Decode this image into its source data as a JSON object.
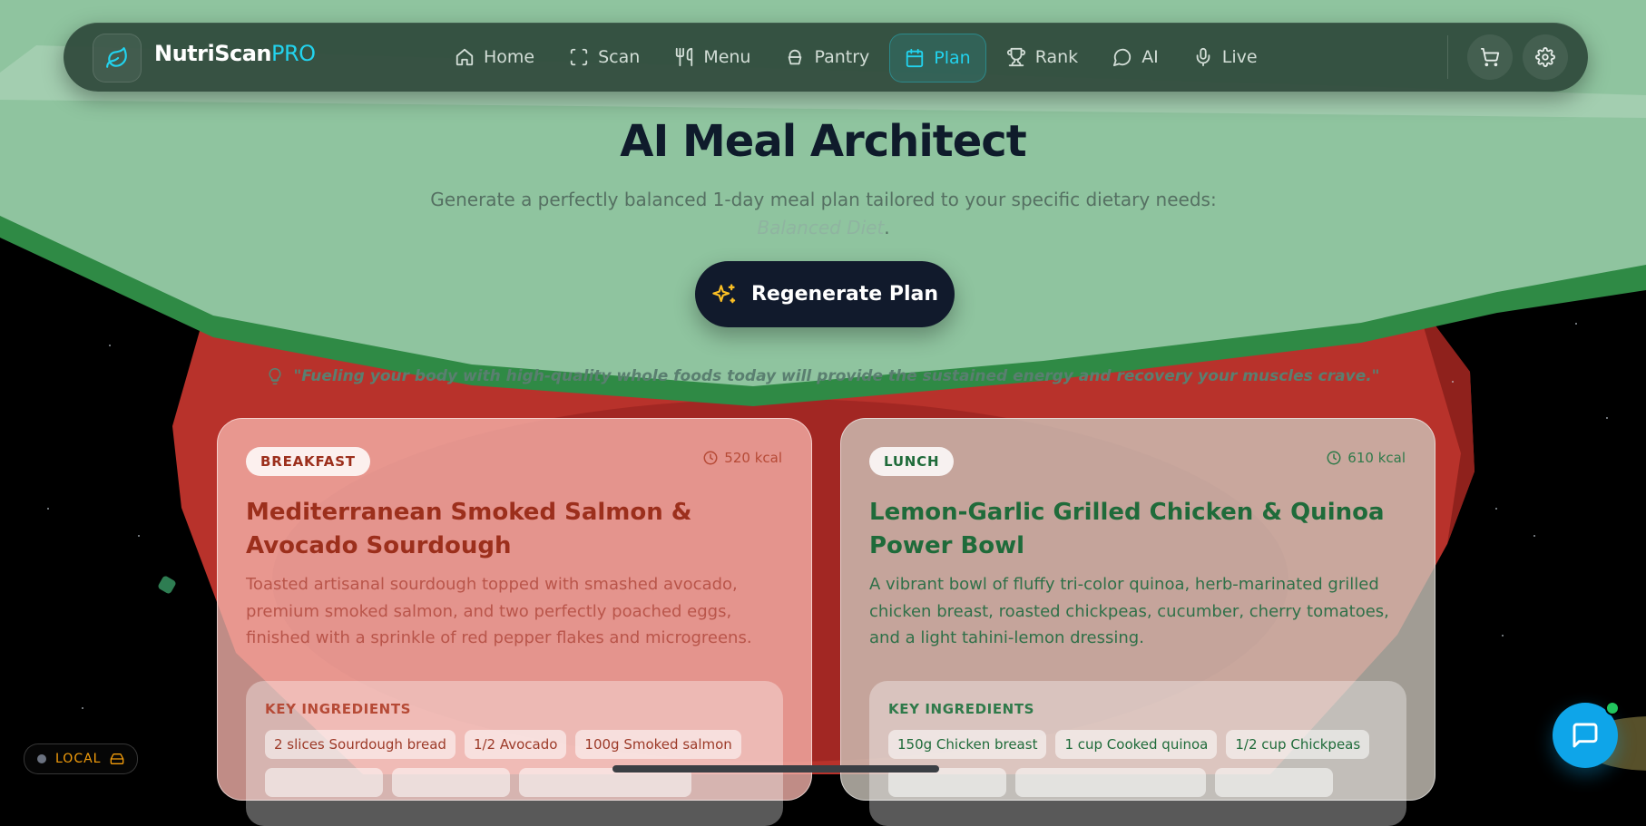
{
  "app": {
    "brand_main": "NutriScan",
    "brand_suffix": "PRO"
  },
  "nav": {
    "items": [
      {
        "label": "Home",
        "icon": "home-icon"
      },
      {
        "label": "Scan",
        "icon": "scan-icon"
      },
      {
        "label": "Menu",
        "icon": "utensils-icon"
      },
      {
        "label": "Pantry",
        "icon": "pantry-icon"
      },
      {
        "label": "Plan",
        "icon": "calendar-icon",
        "active": true
      },
      {
        "label": "Rank",
        "icon": "trophy-icon"
      },
      {
        "label": "AI",
        "icon": "chat-icon"
      },
      {
        "label": "Live",
        "icon": "mic-icon"
      }
    ],
    "right_icons": [
      "cart-icon",
      "gear-icon"
    ]
  },
  "hero": {
    "title": "AI Meal Architect",
    "subtitle_before": "Generate a perfectly balanced 1-day meal plan tailored to your specific dietary needs: ",
    "subtitle_highlight": "Balanced Diet",
    "subtitle_after": ".",
    "button_label": "Regenerate Plan",
    "quote": "\"Fueling your body with high-quality whole foods today will provide the sustained energy and recovery your muscles crave.\""
  },
  "meals": {
    "breakfast": {
      "badge": "BREAKFAST",
      "kcal": "520 kcal",
      "title": "Mediterranean Smoked Salmon & Avocado Sourdough",
      "description": "Toasted artisanal sourdough topped with smashed avocado, premium smoked salmon, and two perfectly poached eggs, finished with a sprinkle of red pepper flakes and microgreens.",
      "ingredients_heading": "KEY INGREDIENTS",
      "ingredients": [
        "2 slices Sourdough bread",
        "1/2 Avocado",
        "100g Smoked salmon"
      ]
    },
    "lunch": {
      "badge": "LUNCH",
      "kcal": "610 kcal",
      "title": "Lemon-Garlic Grilled Chicken & Quinoa Power Bowl",
      "description": "A vibrant bowl of fluffy tri-color quinoa, herb-marinated grilled chicken breast, roasted chickpeas, cucumber, cherry tomatoes, and a light tahini-lemon dressing.",
      "ingredients_heading": "KEY INGREDIENTS",
      "ingredients": [
        "150g Chicken breast",
        "1 cup Cooked quinoa",
        "1/2 cup Chickpeas"
      ]
    }
  },
  "status": {
    "mode": "LOCAL"
  },
  "colors": {
    "accent": "#22d3ee",
    "dark": "#111a2c",
    "chat": "#0ea5e9",
    "green_bg": "#8fc49f",
    "red_bg": "#c8423a"
  }
}
